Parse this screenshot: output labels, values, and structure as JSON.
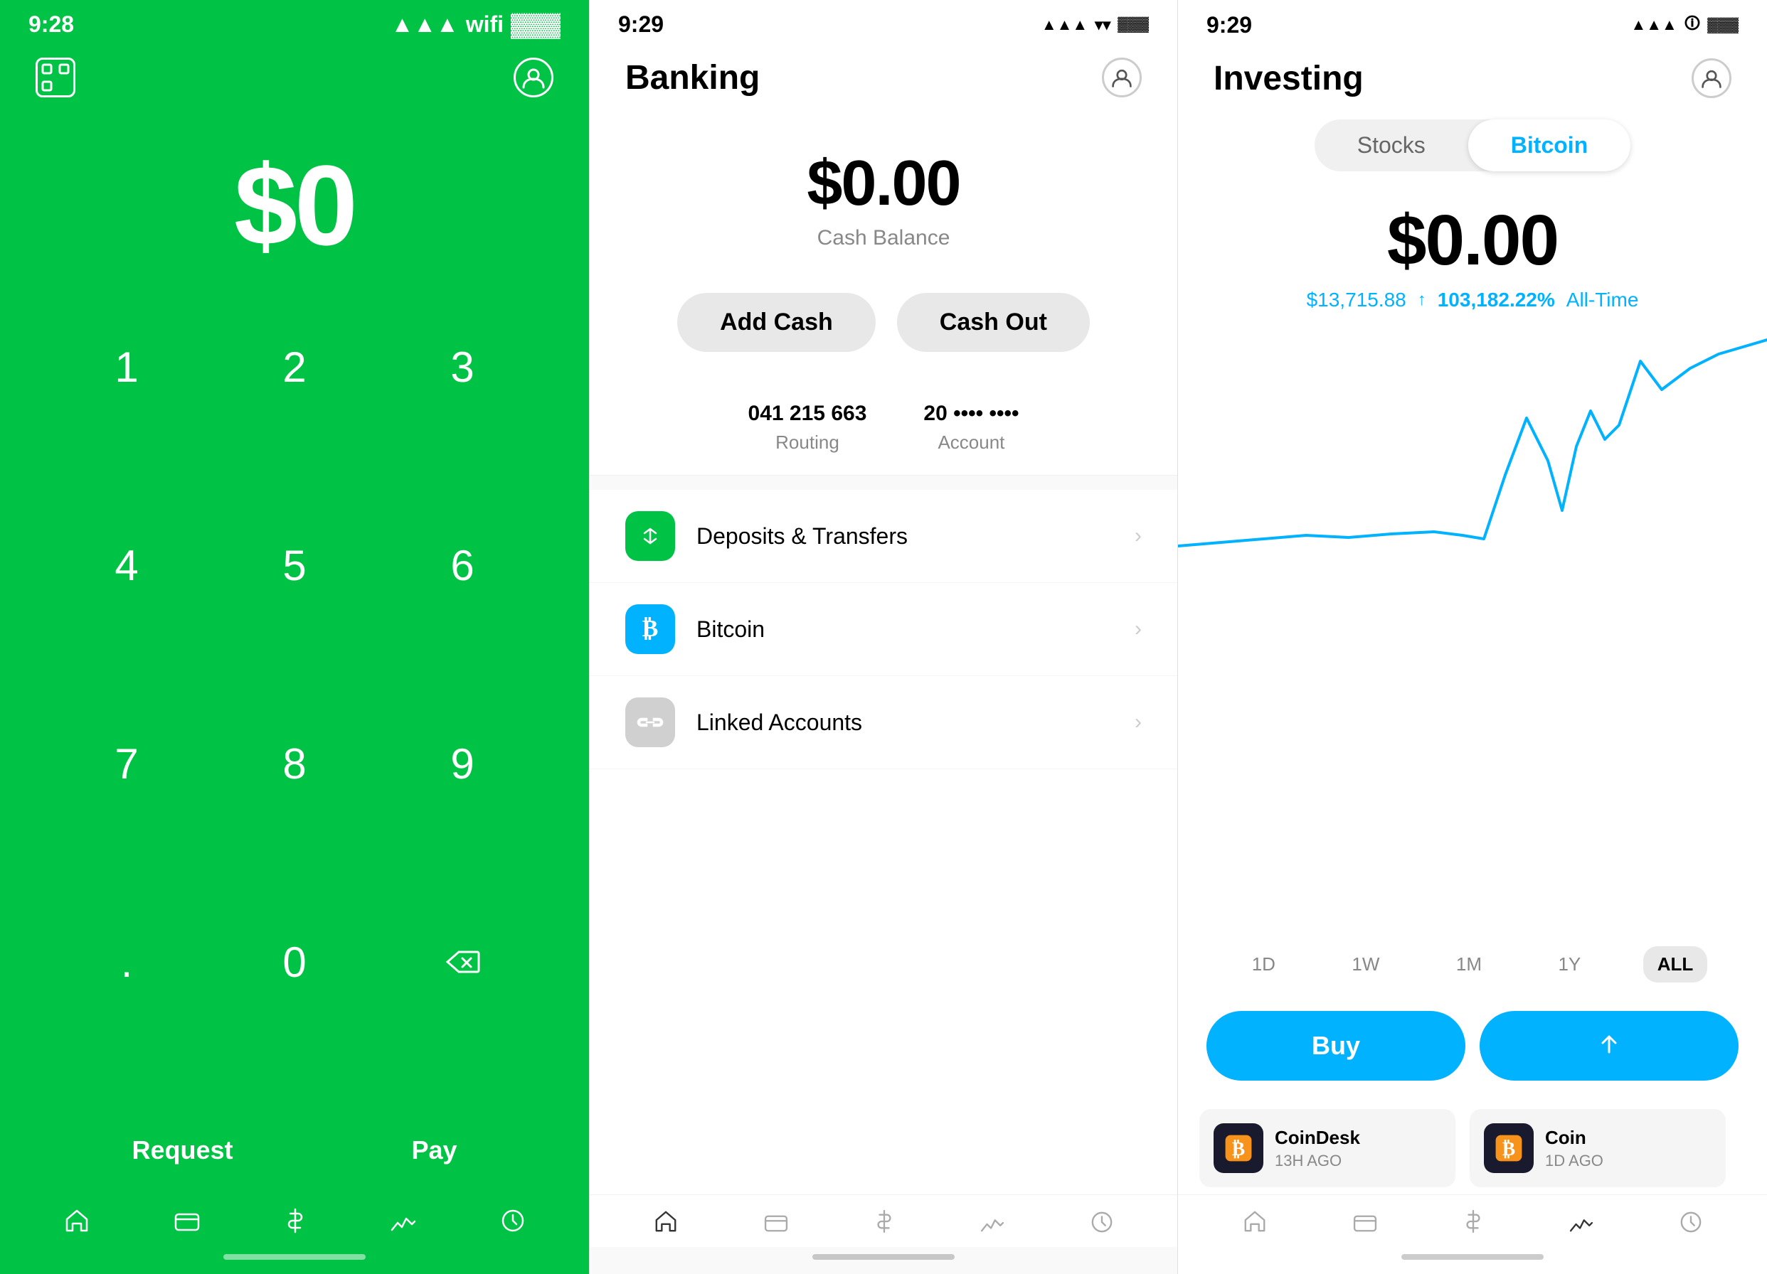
{
  "screen1": {
    "time": "9:28",
    "amount": "$0",
    "numpad": [
      "1",
      "2",
      "3",
      "4",
      "5",
      "6",
      "7",
      "8",
      "9",
      ".",
      "0",
      "⌫"
    ],
    "request_label": "Request",
    "pay_label": "Pay",
    "nav_items": [
      "home",
      "card",
      "dollar",
      "chart",
      "clock"
    ]
  },
  "screen2": {
    "time": "9:29",
    "title": "Banking",
    "cash_amount": "$0.00",
    "cash_label": "Cash Balance",
    "add_cash_label": "Add Cash",
    "cash_out_label": "Cash Out",
    "routing_value": "041 215 663",
    "routing_label": "Routing",
    "account_value": "20 •••• ••••",
    "account_label": "Account",
    "list_items": [
      {
        "label": "Deposits & Transfers",
        "icon_type": "green",
        "icon": "↑↓"
      },
      {
        "label": "Bitcoin",
        "icon_type": "blue",
        "icon": "B"
      },
      {
        "label": "Linked Accounts",
        "icon_type": "gray",
        "icon": "🔗"
      }
    ],
    "nav_items": [
      "home",
      "card",
      "dollar",
      "chart",
      "clock"
    ]
  },
  "screen3": {
    "time": "9:29",
    "title": "Investing",
    "tab_stocks": "Stocks",
    "tab_bitcoin": "Bitcoin",
    "active_tab": "Bitcoin",
    "amount": "$0.00",
    "stat_price": "$13,715.88",
    "stat_arrow": "↑",
    "stat_change": "103,182.22%",
    "stat_period": "All-Time",
    "time_ranges": [
      "1D",
      "1W",
      "1M",
      "1Y",
      "ALL"
    ],
    "active_range": "ALL",
    "buy_label": "Buy",
    "send_label": "Send",
    "news_items": [
      {
        "source": "CoinDesk",
        "time": "13H AGO"
      },
      {
        "source": "Coin",
        "time": "1D AGO"
      }
    ],
    "nav_items": [
      "home",
      "card",
      "dollar",
      "chart",
      "clock"
    ],
    "active_nav": "chart"
  }
}
